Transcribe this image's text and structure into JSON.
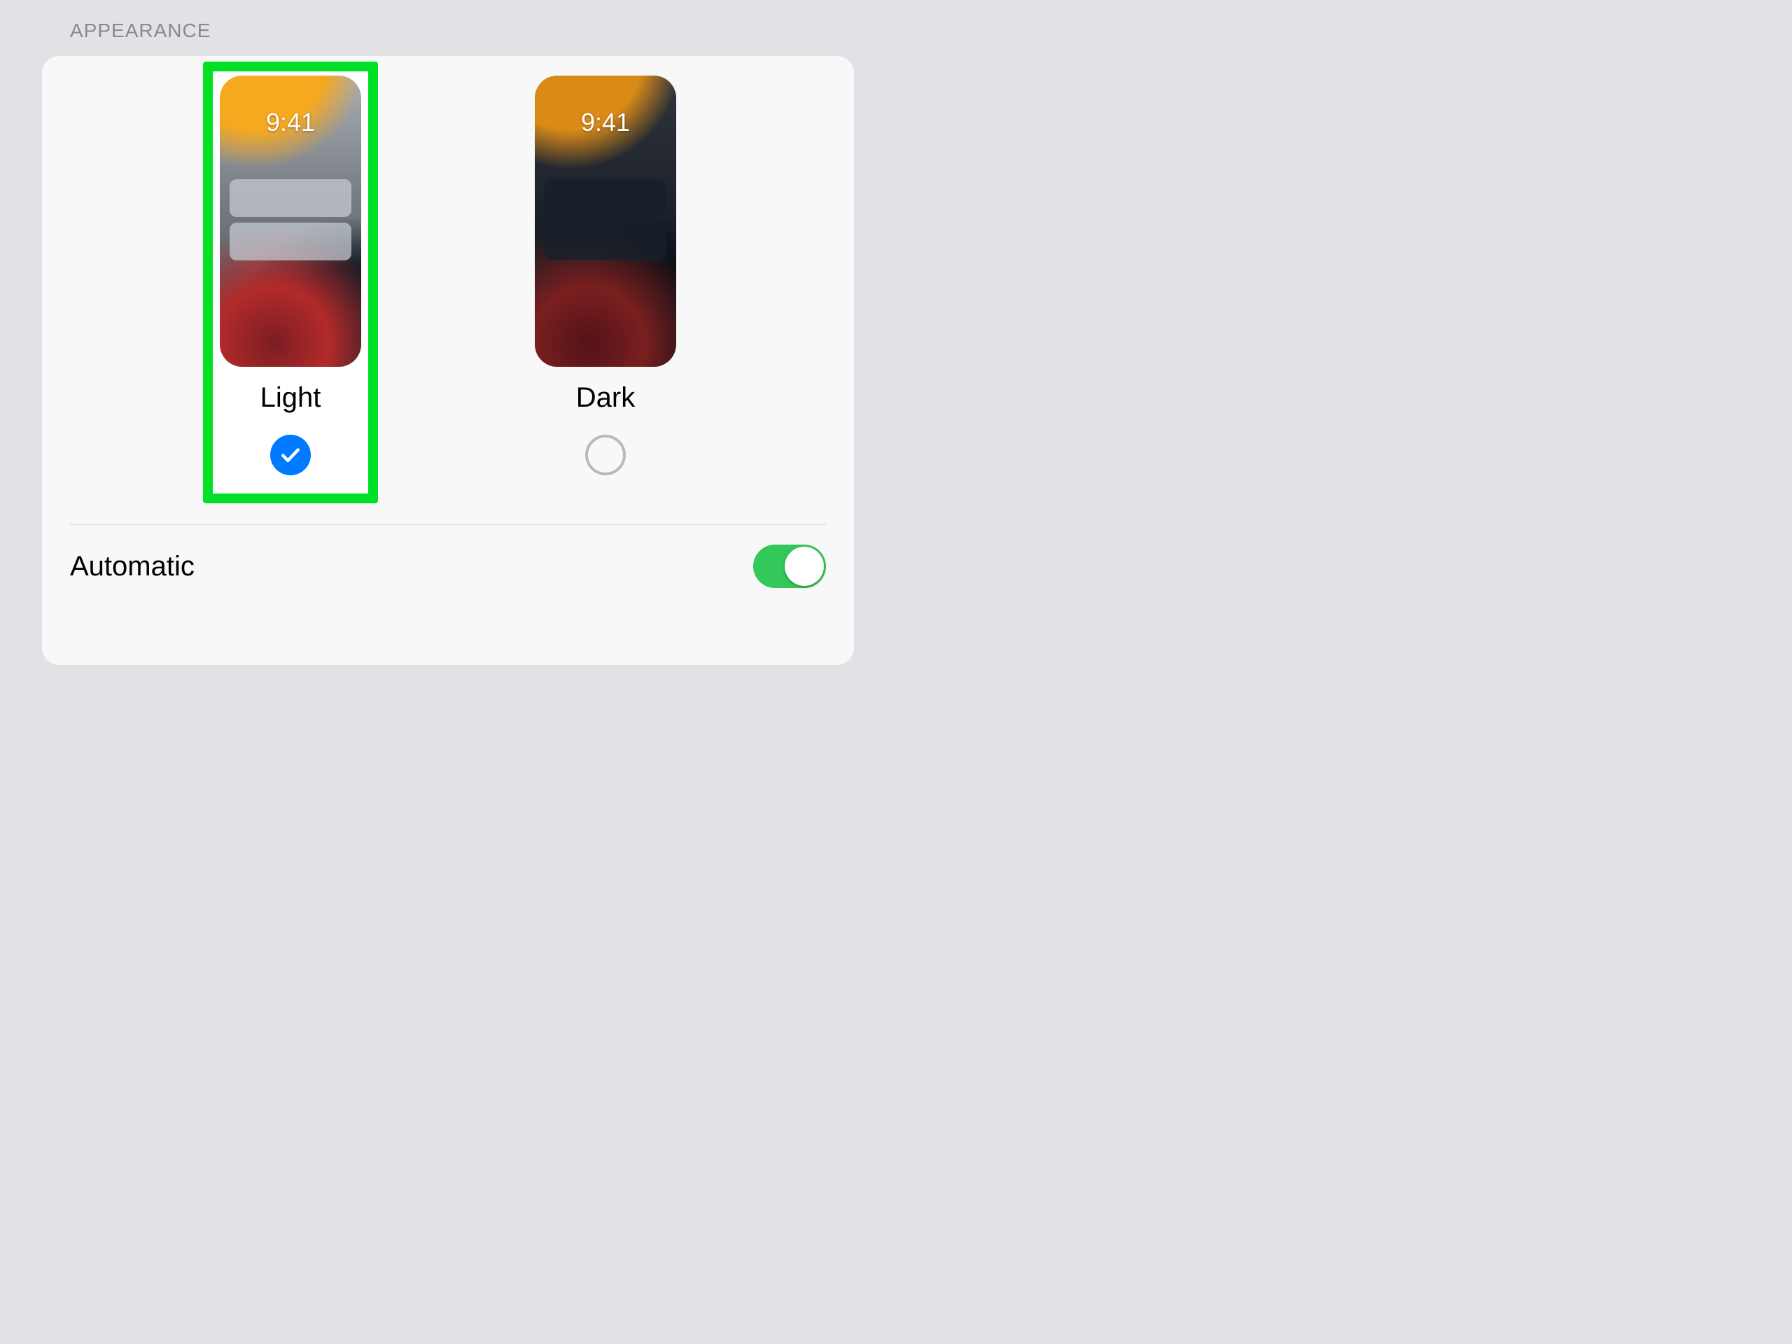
{
  "section": {
    "title": "APPEARANCE"
  },
  "appearance": {
    "preview_time": "9:41",
    "options": {
      "light": {
        "label": "Light",
        "selected": true
      },
      "dark": {
        "label": "Dark",
        "selected": false
      }
    },
    "highlighted_option": "light"
  },
  "automatic": {
    "label": "Automatic",
    "enabled": true
  },
  "colors": {
    "accent_blue": "#007aff",
    "toggle_green": "#34c759",
    "highlight_green": "#00e126"
  }
}
